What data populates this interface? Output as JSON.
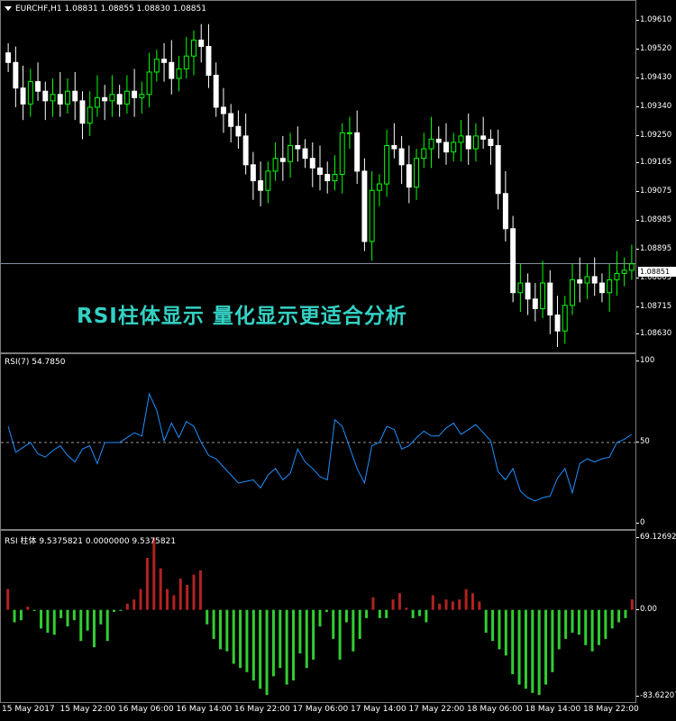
{
  "main": {
    "symbol_title": "EURCHF,H1  1.08831 1.08855 1.08830 1.08851",
    "current_price": "1.08851",
    "overlay_text": "RSI柱体显示  量化显示更适合分析",
    "price_ticks": [
      "1.09610",
      "1.09520",
      "1.09430",
      "1.09340",
      "1.09250",
      "1.09165",
      "1.09075",
      "1.08985",
      "1.08895",
      "1.08805",
      "1.08715",
      "1.08630"
    ]
  },
  "rsi": {
    "title": "RSI(7) 54.7850",
    "ticks": [
      "100",
      "50",
      "0"
    ]
  },
  "hist": {
    "title": "RSI 柱体 9.5375821 0.0000000 9.5375821",
    "ticks": [
      "69.12692",
      "0.00",
      "-83.62207"
    ]
  },
  "time_labels": [
    "15 May 2017",
    "15 May 22:00",
    "16 May 06:00",
    "16 May 14:00",
    "16 May 22:00",
    "17 May 06:00",
    "17 May 14:00",
    "17 May 22:00",
    "18 May 06:00",
    "18 May 14:00",
    "18 May 22:00"
  ],
  "colors": {
    "bull": "#00ff00",
    "bear": "#ffffff",
    "rsi_line": "#1e90ff",
    "hist_up": "#b22222",
    "hist_down": "#32cd32",
    "grid": "#7c7c7c"
  },
  "chart_data": [
    {
      "type": "candlestick",
      "title": "EURCHF,H1",
      "ylim": [
        1.0859,
        1.0965
      ],
      "close": [
        1.0948,
        1.094,
        1.0935,
        1.0942,
        1.0939,
        1.0936,
        1.0938,
        1.0935,
        1.0939,
        1.0936,
        1.0929,
        1.0934,
        1.0937,
        1.0936,
        1.0938,
        1.0935,
        1.0939,
        1.0937,
        1.0938,
        1.0945,
        1.0949,
        1.0948,
        1.0943,
        1.0946,
        1.095,
        1.0955,
        1.0953,
        1.0944,
        1.0934,
        1.0932,
        1.0928,
        1.0925,
        1.0916,
        1.0911,
        1.0908,
        1.0914,
        1.0918,
        1.0917,
        1.0922,
        1.0921,
        1.0918,
        1.0915,
        1.0913,
        1.0911,
        1.0913,
        1.0926,
        1.0926,
        1.0914,
        1.0892,
        1.0908,
        1.091,
        1.0922,
        1.0921,
        1.0916,
        1.0909,
        1.0918,
        1.0921,
        1.0924,
        1.0923,
        1.092,
        1.0923,
        1.0925,
        1.0921,
        1.0925,
        1.0924,
        1.0922,
        1.0907,
        1.0896,
        1.0876,
        1.0879,
        1.0874,
        1.0871,
        1.0879,
        1.0869,
        1.0864,
        1.0872,
        1.088,
        1.0879,
        1.0881,
        1.0879,
        1.0876,
        1.088,
        1.0882,
        1.0883,
        1.0885
      ],
      "volatility_style": "OHLC bars reconstructed"
    },
    {
      "type": "line",
      "title": "RSI(7) 54.7850",
      "ylim": [
        0,
        100
      ],
      "reference_line": 50,
      "values": [
        60,
        44,
        47,
        50,
        43,
        41,
        45,
        48,
        42,
        38,
        46,
        48,
        37,
        50,
        50,
        50,
        53,
        56,
        54,
        80,
        70,
        51,
        62,
        53,
        63,
        60,
        50,
        42,
        40,
        35,
        30,
        25,
        26,
        27,
        22,
        30,
        34,
        27,
        31,
        46,
        38,
        34,
        29,
        27,
        64,
        60,
        47,
        34,
        25,
        48,
        50,
        60,
        58,
        46,
        48,
        53,
        57,
        54,
        54,
        59,
        62,
        55,
        58,
        61,
        56,
        51,
        32,
        27,
        34,
        20,
        16,
        14,
        16,
        17,
        28,
        34,
        19,
        37,
        40,
        38,
        40,
        41,
        50,
        52,
        55
      ]
    },
    {
      "type": "bar",
      "title": "RSI 柱体 9.5375821 0.0000000 9.5375821",
      "ylim": [
        -83.62207,
        69.12692
      ],
      "values": [
        20,
        -12,
        -10,
        3,
        -1,
        -18,
        -22,
        -24,
        -8,
        -16,
        -10,
        -30,
        -20,
        -36,
        -14,
        -30,
        -2,
        -1,
        6,
        10,
        20,
        50,
        69,
        40,
        20,
        14,
        30,
        24,
        34,
        38,
        -14,
        -28,
        -38,
        -40,
        -52,
        -56,
        -60,
        -68,
        -76,
        -82,
        -64,
        -56,
        -72,
        -68,
        -42,
        -56,
        -48,
        -16,
        -2,
        -28,
        -48,
        -12,
        -40,
        -28,
        -8,
        12,
        -8,
        -8,
        10,
        16,
        2,
        -8,
        -6,
        -12,
        14,
        6,
        10,
        8,
        10,
        20,
        16,
        8,
        -22,
        -30,
        -38,
        -44,
        -62,
        -72,
        -76,
        -80,
        -82,
        -72,
        -60,
        -38,
        -28,
        -22,
        -24,
        -34,
        -40,
        -34,
        -28,
        -18,
        -12,
        -8,
        10
      ]
    }
  ]
}
